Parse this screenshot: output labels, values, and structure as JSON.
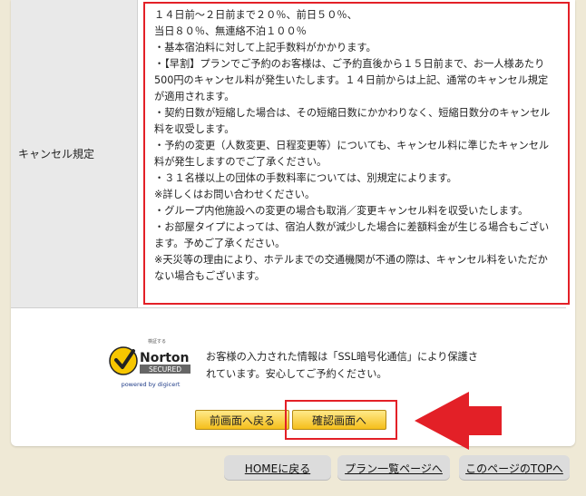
{
  "cancel": {
    "label": "キャンセル規定",
    "text": "１４日前～２日前まで２０％、前日５０％、\n当日８０％、無連絡不泊１００％\n・基本宿泊料に対して上記手数料がかかります。\n・【早割】プランでご予約のお客様は、ご予約直後から１５日前まで、お一人様あたり500円のキャンセル料が発生いたします。１４日前からは上記、通常のキャンセル規定が適用されます。\n・契約日数が短縮した場合は、その短縮日数にかかわりなく、短縮日数分のキャンセル料を収受します。\n・予約の変更（人数変更、日程変更等）についても、キャンセル料に準じたキャンセル料が発生しますのでご了承ください。\n・３１名様以上の団体の手数料率については、別規定によります。\n※詳しくはお問い合わせください。\n・グループ内他施設への変更の場合も取消／変更キャンセル料を収受いたします。\n・お部屋タイプによっては、宿泊人数が減少した場合に差額料金が生じる場合もございます。予めご了承ください。\n※天災等の理由により、ホテルまでの交通機関が不通の際は、キャンセル料をいただかない場合もございます。"
  },
  "security": {
    "badge_top": "検証する",
    "badge_brand": "Norton",
    "badge_secured": "SECURED",
    "badge_powered": "powered by digicert",
    "message": "お客様の入力された情報は「SSL暗号化通信」により保護されています。安心してご予約ください。"
  },
  "buttons": {
    "back": "前画面へ戻る",
    "confirm": "確認画面へ"
  },
  "nav": {
    "home": "HOMEに戻る",
    "plans": "プラン一覧ページへ",
    "top": "このページのTOPへ"
  },
  "colors": {
    "highlight": "#e32027",
    "button": "#f5bf1b",
    "norton_yellow": "#f7c600"
  }
}
